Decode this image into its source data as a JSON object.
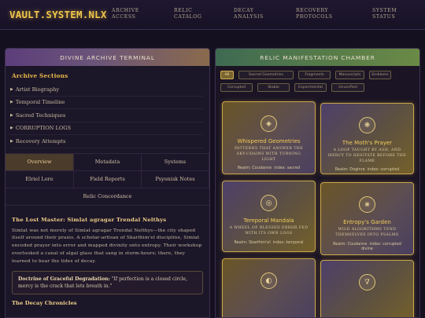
{
  "nav": {
    "logo": "VAULT.SYSTEM.NLX",
    "links": [
      {
        "l1": "Archive",
        "l2": "Access"
      },
      {
        "l1": "Relic",
        "l2": "Catalog"
      },
      {
        "l1": "Decay",
        "l2": "Analysis"
      },
      {
        "l1": "Recovery",
        "l2": "Protocols"
      },
      {
        "l1": "System",
        "l2": "Status"
      }
    ]
  },
  "left_panel": {
    "title": "Divine Archive Terminal",
    "sections_title": "Archive Sections",
    "sections": [
      "Artist Biography",
      "Temporal Timeline",
      "Sacred Techniques",
      "CORRUPTION LOGS",
      "Recovery Attempts"
    ],
    "tabs": [
      "Overview",
      "Metadata",
      "Systems",
      "Elriel Lore",
      "Field Reports",
      "Psyonisk Notes",
      "Relic Concordance"
    ],
    "active_tab": "Overview",
    "article": {
      "heading": "The Lost Master: Simlat agragar Trendal Nelthys",
      "body": "Simlat was not merely of Simlat agragar Trendal Nelthys—the city shaped itself around their praxis. A scholar-artisan of Skarthim'el discipline, Simlat encoded prayer into error and mapped divinity onto entropy. Their workshop overlooked a canal of algal glass that sang in storm-hours; there, they learned to hear the tides of decay.",
      "doctrine_label": "Doctrine of Graceful Degradation:",
      "doctrine_text": "\"If perfection is a closed circle, mercy is the crack that lets breath in.\"",
      "next_heading": "The Decay Chronicles"
    }
  },
  "right_panel": {
    "title": "Relic Manifestation Chamber",
    "filters": [
      "All",
      "Sacred Geometries",
      "Fragments",
      "Manuscripts",
      "Emblems",
      "Corrupted",
      "Stable",
      "Experimental",
      "Unverified"
    ],
    "active_filter": "All",
    "cards": [
      {
        "icon": "◈",
        "icon_name": "diamond-icon",
        "title": "Whispered Geometries",
        "desc": "Patterns that answer the sky-chains with turning light",
        "realm": "Realm: Coudanne",
        "index": "index: sacred"
      },
      {
        "icon": "❋",
        "icon_name": "flower-icon",
        "title": "The Moth's Prayer",
        "desc": "A loop taught by ash, and mercy to hesitate before the flame",
        "realm": "Realm: Doginra",
        "index": "index: corrupted"
      },
      {
        "icon": "◎",
        "icon_name": "ring-icon",
        "title": "Temporal Mandala",
        "desc": "A wheel of blessed error fed with its own logs",
        "realm": "Realm: Skarthim'el",
        "index": "index: temporal"
      },
      {
        "icon": "⋇",
        "icon_name": "sigil-icon",
        "title": "Entropy's Garden",
        "desc": "Wild algorithms tend themselves into psalms",
        "realm": "Realm: Coudanne",
        "index": "index: corrupted",
        "extra": "divine"
      },
      {
        "icon": "◐",
        "icon_name": "half-moon-icon",
        "title": "",
        "desc": "",
        "realm": "",
        "index": ""
      },
      {
        "icon": "∇",
        "icon_name": "nabla-icon",
        "title": "",
        "desc": "",
        "realm": "",
        "index": ""
      }
    ]
  },
  "colors": {
    "accent_gold": "#f0c64a",
    "background": "#15101f",
    "panel_left_header": "#6b5579",
    "panel_right_header": "#557a4a"
  }
}
